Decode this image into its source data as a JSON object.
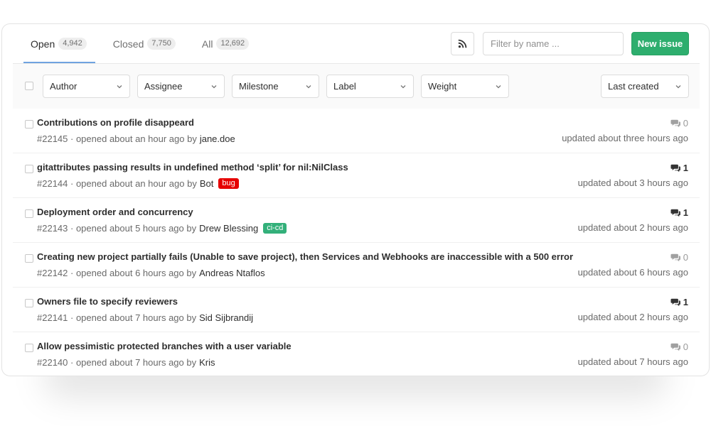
{
  "tabs": [
    {
      "label": "Open",
      "count": "4,942",
      "active": true
    },
    {
      "label": "Closed",
      "count": "7,750",
      "active": false
    },
    {
      "label": "All",
      "count": "12,692",
      "active": false
    }
  ],
  "toolbar": {
    "rss_icon": "rss-icon",
    "filter_placeholder": "Filter by name ...",
    "new_issue_label": "New issue"
  },
  "filters": [
    {
      "label": "Author"
    },
    {
      "label": "Assignee"
    },
    {
      "label": "Milestone"
    },
    {
      "label": "Label"
    },
    {
      "label": "Weight"
    }
  ],
  "sort": {
    "label": "Last created"
  },
  "colors": {
    "accent": "#2eae6e",
    "tab_underline": "#6fa3e0",
    "label_bug": "#e60000",
    "label_cicd": "#33b07a"
  },
  "issues": [
    {
      "title": "Contributions on profile disappeard",
      "id": "#22145",
      "opened": "· opened about an hour ago by",
      "author": "jane.doe",
      "labels": [],
      "comments": "0",
      "updated": "updated about three hours ago"
    },
    {
      "title": "gitattributes passing results in undefined method ‘split’ for nil:NilClass",
      "id": "#22144",
      "opened": "· opened about an hour ago by",
      "author": "Bot",
      "labels": [
        {
          "text": "bug",
          "color": "#e60000"
        }
      ],
      "comments": "1",
      "updated": "updated about 3 hours ago"
    },
    {
      "title": "Deployment order and concurrency",
      "id": "#22143",
      "opened": "· opened about 5 hours ago by",
      "author": "Drew Blessing",
      "labels": [
        {
          "text": "ci-cd",
          "color": "#33b07a"
        }
      ],
      "comments": "1",
      "updated": "updated about 2 hours ago"
    },
    {
      "title": "Creating new project partially fails (Unable to save project), then Services and Webhooks are inaccessible with a 500 error",
      "id": "#22142",
      "opened": "· opened about 6 hours ago by",
      "author": "Andreas Ntaflos",
      "labels": [],
      "comments": "0",
      "updated": "updated about 6 hours ago"
    },
    {
      "title": "Owners file to specify reviewers",
      "id": "#22141",
      "opened": "· opened about 7 hours ago by",
      "author": "Sid Sijbrandij",
      "labels": [],
      "comments": "1",
      "updated": "updated about 2 hours ago"
    },
    {
      "title": "Allow pessimistic protected branches with a user variable",
      "id": "#22140",
      "opened": "· opened about 7 hours ago by",
      "author": "Kris",
      "labels": [],
      "comments": "0",
      "updated": "updated about 7 hours ago"
    }
  ]
}
